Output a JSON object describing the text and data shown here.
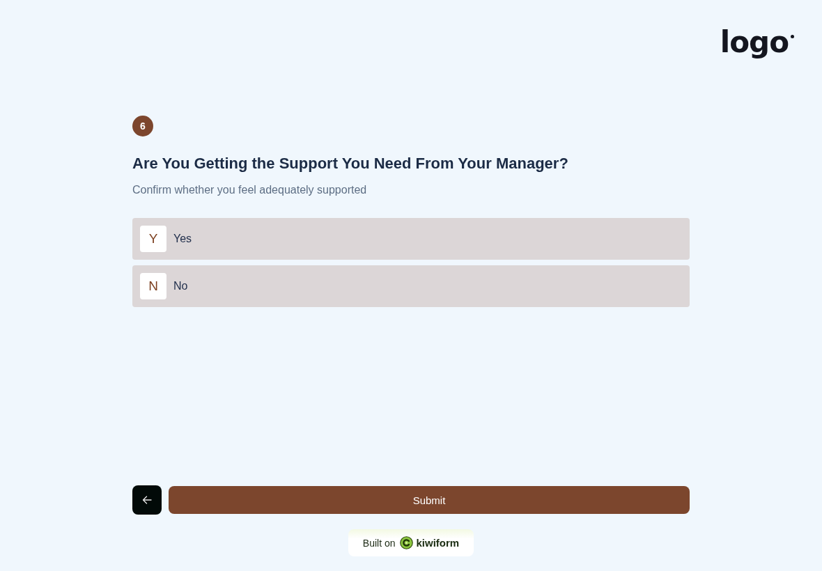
{
  "logo": "logo",
  "question": {
    "number": "6",
    "title": "Are You Getting the Support You Need From Your Manager?",
    "description": "Confirm whether you feel adequately supported"
  },
  "options": [
    {
      "key": "Y",
      "label": "Yes",
      "selected": false
    },
    {
      "key": "N",
      "label": "No",
      "selected": false
    }
  ],
  "submit_button": {
    "label": "Submit"
  },
  "badge": {
    "prefix": "Built on",
    "brand": "kiwiform"
  }
}
